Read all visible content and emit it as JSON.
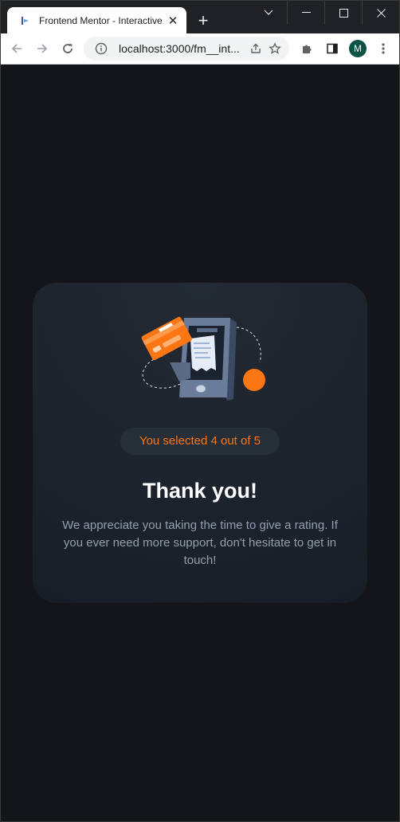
{
  "browser": {
    "tab": {
      "title": "Frontend Mentor - Interactive"
    },
    "address_bar": {
      "url": "localhost:3000/fm__int..."
    },
    "profile_initial": "M"
  },
  "icons": {
    "favicon": "frontend-mentor-icon",
    "back": "arrow-left-icon",
    "forward": "arrow-right-icon",
    "reload": "reload-icon",
    "site_info": "info-icon",
    "share": "share-icon",
    "bookmark": "star-icon",
    "extensions": "puzzle-icon",
    "side_panel": "side-panel-icon",
    "menu": "kebab-menu-icon"
  },
  "thank_you": {
    "selected_text": "You selected 4 out of 5",
    "title": "Thank you!",
    "message": "We appreciate you taking the time to give a rating. If you ever need more support, don't hesitate to get in touch!"
  },
  "colors": {
    "accent": "#fc7614",
    "card_bg": "#1e252e",
    "page_bg": "#131518",
    "body_text": "#959eac"
  }
}
